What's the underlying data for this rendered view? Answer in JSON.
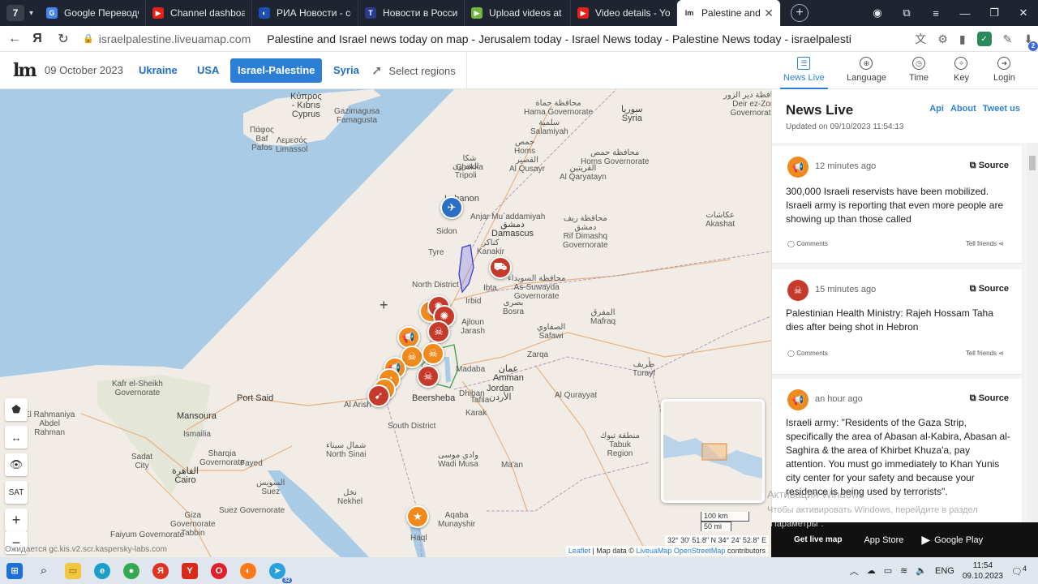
{
  "browser": {
    "tab_count": "7",
    "tabs": [
      {
        "title": "Google Переводчик",
        "fav": "G",
        "color": "#4285f4"
      },
      {
        "title": "Channel dashboard",
        "fav": "▶",
        "color": "#e62117"
      },
      {
        "title": "РИА Новости - соб",
        "fav": "◐",
        "color": "#1a4fb4"
      },
      {
        "title": "Новости в России",
        "fav": "T",
        "color": "#2a3a8c"
      },
      {
        "title": "Upload videos at R",
        "fav": "▶",
        "color": "#74b43a"
      },
      {
        "title": "Video details - YouT",
        "fav": "▶",
        "color": "#e62117"
      },
      {
        "title": "Palestine and Isr",
        "fav": "lm",
        "color": "#ffffff"
      }
    ],
    "url": "israelpalestine.liveuamap.com",
    "page_title": "Palestine and Israel news today on map - Jerusalem today - Israel News today - Palestine News today - israelpalestine.l...",
    "download_badge": "2"
  },
  "header": {
    "date": "09 October 2023",
    "regions": [
      "Ukraine",
      "USA",
      "Israel-Palestine",
      "Syria"
    ],
    "select_regions": "Select regions",
    "menu": [
      "News Live",
      "Language",
      "Time",
      "Key",
      "Login"
    ]
  },
  "map": {
    "labels": [
      {
        "t": "Κύπρος\n- Kıbrıs\nCyprus",
        "k": "big"
      },
      {
        "t": "Gazimagusa\nFamagusta",
        "k": ""
      },
      {
        "t": "Πάφος\nBaf\nPafos",
        "k": ""
      },
      {
        "t": "Λεμεσός\nLimassol",
        "k": ""
      },
      {
        "t": "محافظة حماة\nHama Governorate",
        "k": ""
      },
      {
        "t": "سلمية\nSalamiyah",
        "k": ""
      },
      {
        "t": "سوريا\nSyria",
        "k": "big"
      },
      {
        "t": "محافظة دير الزور\nDeir ez-Zor\nGovernorate",
        "k": ""
      },
      {
        "t": "حمص\nHoms",
        "k": ""
      },
      {
        "t": "محافظة حمص\nHoms Governorate",
        "k": ""
      },
      {
        "t": "القصير\nAl Qusayr",
        "k": ""
      },
      {
        "t": "القريتين\nAl Qaryatayn",
        "k": ""
      },
      {
        "t": "شكا\nChekka",
        "k": ""
      },
      {
        "t": "الشرون\nTripoli",
        "k": ""
      },
      {
        "t": "Lebanon",
        "k": "big"
      },
      {
        "t": "Anjar Mu`addamiyah",
        "k": ""
      },
      {
        "t": "Sidon",
        "k": ""
      },
      {
        "t": "دمشق\nDamascus",
        "k": "cy"
      },
      {
        "t": "محافظة ريف\nدمشق\nRif Dimashq\nGovernorate",
        "k": ""
      },
      {
        "t": "عكاشات\nAkashat",
        "k": ""
      },
      {
        "t": "Tyre",
        "k": ""
      },
      {
        "t": "كناكر\nKanakir",
        "k": ""
      },
      {
        "t": "North District",
        "k": ""
      },
      {
        "t": "Ibta",
        "k": ""
      },
      {
        "t": "محافظة السويداء\nAs-Suwayda\nGovernorate",
        "k": ""
      },
      {
        "t": "Irbid",
        "k": ""
      },
      {
        "t": "بصرى\nBosra",
        "k": ""
      },
      {
        "t": "Ajloun\nJarash",
        "k": ""
      },
      {
        "t": "المفرق\nMafraq",
        "k": ""
      },
      {
        "t": "الصفاوي\nSafawi",
        "k": ""
      },
      {
        "t": "Zarqa",
        "k": ""
      },
      {
        "t": "عمان\nAmman",
        "k": "cy"
      },
      {
        "t": "Madaba",
        "k": ""
      },
      {
        "t": "طريف\nTurayf",
        "k": ""
      },
      {
        "t": "Jordan\nالأردن",
        "k": "big"
      },
      {
        "t": "Al Qurayyat",
        "k": ""
      },
      {
        "t": "Beersheba",
        "k": "cy"
      },
      {
        "t": "South District",
        "k": ""
      },
      {
        "t": "Al Arish",
        "k": ""
      },
      {
        "t": "Port Said",
        "k": "cy"
      },
      {
        "t": "Kafr el-Sheikh\nGovernorate",
        "k": ""
      },
      {
        "t": "Mansoura",
        "k": "cy"
      },
      {
        "t": "El Rahmaniya\nAbdel\nRahman",
        "k": ""
      },
      {
        "t": "Ismailia",
        "k": ""
      },
      {
        "t": "شمال سيناء\nNorth Sinai",
        "k": ""
      },
      {
        "t": "Sharqia\nGovernorate",
        "k": ""
      },
      {
        "t": "Sadat\nCity",
        "k": ""
      },
      {
        "t": "Fayed",
        "k": ""
      },
      {
        "t": "القاهرة\nCairo",
        "k": "cy"
      },
      {
        "t": "السويس\nSuez",
        "k": ""
      },
      {
        "t": "نخل\nNekhel",
        "k": ""
      },
      {
        "t": "Suez Governorate",
        "k": ""
      },
      {
        "t": "Giza\nGovernorate\nTabbin",
        "k": ""
      },
      {
        "t": "Faiyum Governorate",
        "k": ""
      },
      {
        "t": "وادي موسى\nWadi Musa",
        "k": ""
      },
      {
        "t": "Ma'an",
        "k": ""
      },
      {
        "t": "منطقة تبوك\nTabuk\nRegion",
        "k": ""
      },
      {
        "t": "Aqaba\nMunayshir",
        "k": ""
      },
      {
        "t": "Haql",
        "k": ""
      },
      {
        "t": "Tafila",
        "k": ""
      },
      {
        "t": "Dhiban",
        "k": ""
      },
      {
        "t": "Karak",
        "k": ""
      }
    ],
    "coords": "32° 30' 51.8\" N 34° 24' 52.8\" E",
    "scale_km": "100 km",
    "scale_mi": "50 mi",
    "attribution_leaflet": "Leaflet",
    "attribution_text": "| Map data ©",
    "attribution_link": "LiveuaMap OpenStreetMap",
    "attribution_tail": "contributors",
    "status_url": "Ожидается gc.kis.v2.scr.kaspersky-labs.com",
    "controls": [
      "⬟",
      "↔",
      "👁",
      "SAT",
      "+",
      "−"
    ]
  },
  "news": {
    "title": "News Live",
    "links": [
      "Api",
      "About",
      "Tweet us"
    ],
    "updated": "Updated on 09/10/2023 11:54:13",
    "items": [
      {
        "time": "12 minutes ago",
        "source": "Source",
        "text": "300,000 Israeli reservists have been mobilized. Israeli army is reporting that even more people are showing up than those called",
        "comments": "Comments",
        "tell": "Tell friends",
        "icon": "megaphone",
        "color": "#f08a1c"
      },
      {
        "time": "15 minutes ago",
        "source": "Source",
        "text": "Palestinian Health Ministry: Rajeh Hossam Taha dies after being shot in Hebron",
        "comments": "Comments",
        "tell": "Tell friends",
        "icon": "skull",
        "color": "#c53a2b"
      },
      {
        "time": "an hour ago",
        "source": "Source",
        "text": "Israeli army: \"Residents of the Gaza Strip, specifically the area of Abasan al-Kabira, Abasan al-Saghira & the area of Khirbet Khuza'a, pay attention. You must go immediately to Khan Yunis city center for your safety and because your residence is being used by terrorists\".",
        "comments": "",
        "tell": "",
        "icon": "megaphone",
        "color": "#f08a1c"
      }
    ]
  },
  "appbar": {
    "get_live_map": "Get live map",
    "app_store": "App Store",
    "google_play": "Google Play"
  },
  "watermark": {
    "line1": "Активация Windows",
    "line2": "Чтобы активировать Windows, перейдите в раздел",
    "line3": "\"Параметры\"."
  },
  "taskbar": {
    "lang": "ENG",
    "time": "11:54",
    "date": "09.10.2023",
    "notif": "4",
    "telegram_badge": "32"
  }
}
